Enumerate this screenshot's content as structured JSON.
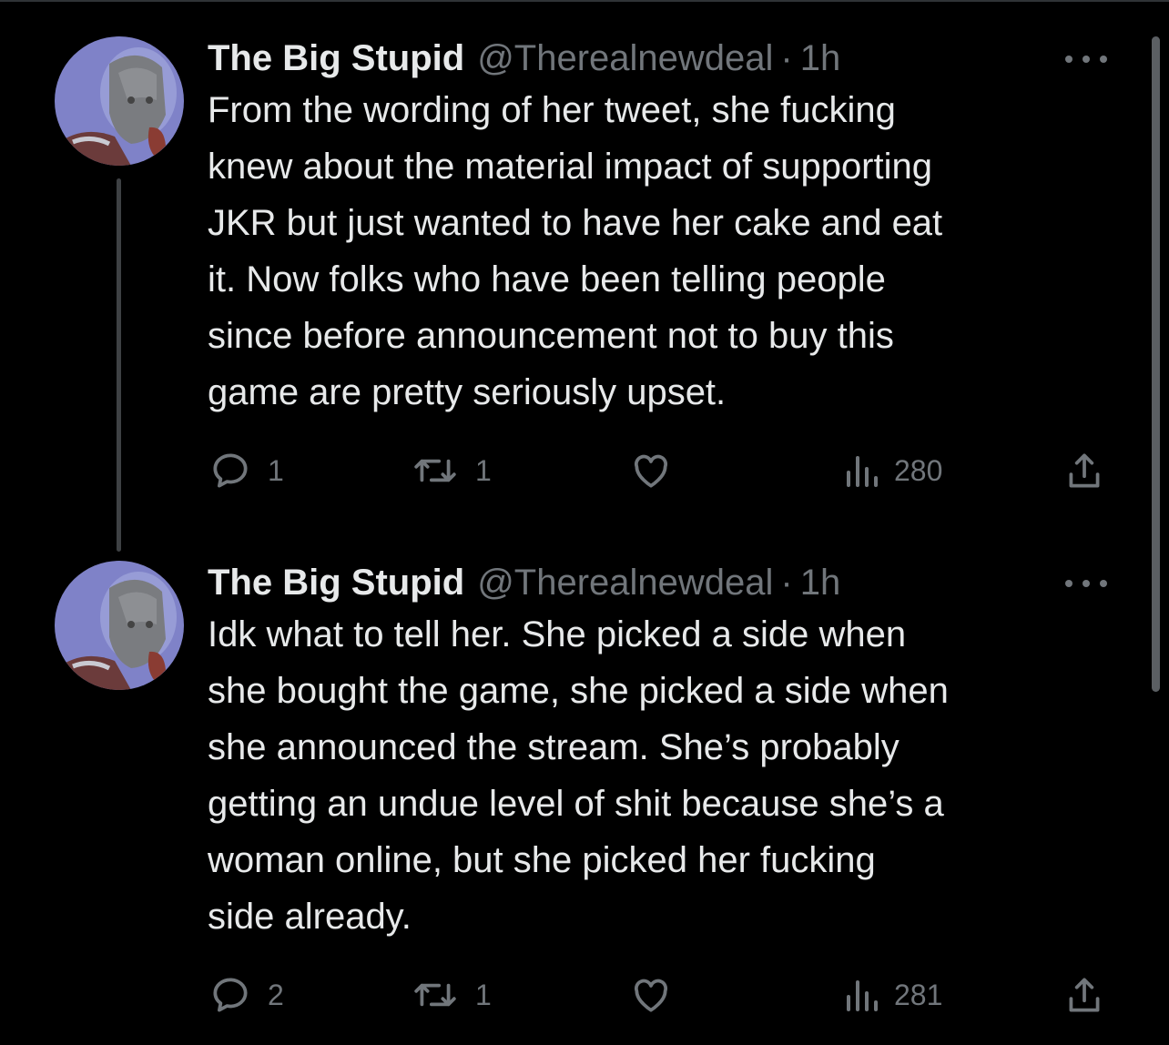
{
  "tweets": [
    {
      "name": "The Big Stupid",
      "handle": "@Therealnewdeal",
      "separator": "·",
      "time": "1h",
      "text": "From the wording of her tweet, she fucking\nknew about the material impact of supporting\nJKR but just wanted to have her cake and eat\nit. Now folks who have been telling people\nsince before announcement not to buy this\ngame are pretty seriously upset.",
      "replies": "1",
      "retweets": "1",
      "views": "280"
    },
    {
      "name": "The Big Stupid",
      "handle": "@Therealnewdeal",
      "separator": "·",
      "time": "1h",
      "text": "Idk what to tell her. She picked a side when\nshe bought the game, she picked a side when\nshe announced the stream. She’s probably\ngetting an undue level of shit because she’s a\nwoman online, but she picked her fucking\nside already.",
      "replies": "2",
      "retweets": "1",
      "views": "281"
    }
  ],
  "icons": {
    "reply": "reply-icon",
    "retweet": "retweet-icon",
    "like": "heart-icon",
    "views": "views-icon",
    "share": "share-icon",
    "more": "more-icon"
  },
  "colors": {
    "background": "#000000",
    "text": "#e7e9ea",
    "muted": "#71767b",
    "avatar_bg": "#7f82c8"
  }
}
